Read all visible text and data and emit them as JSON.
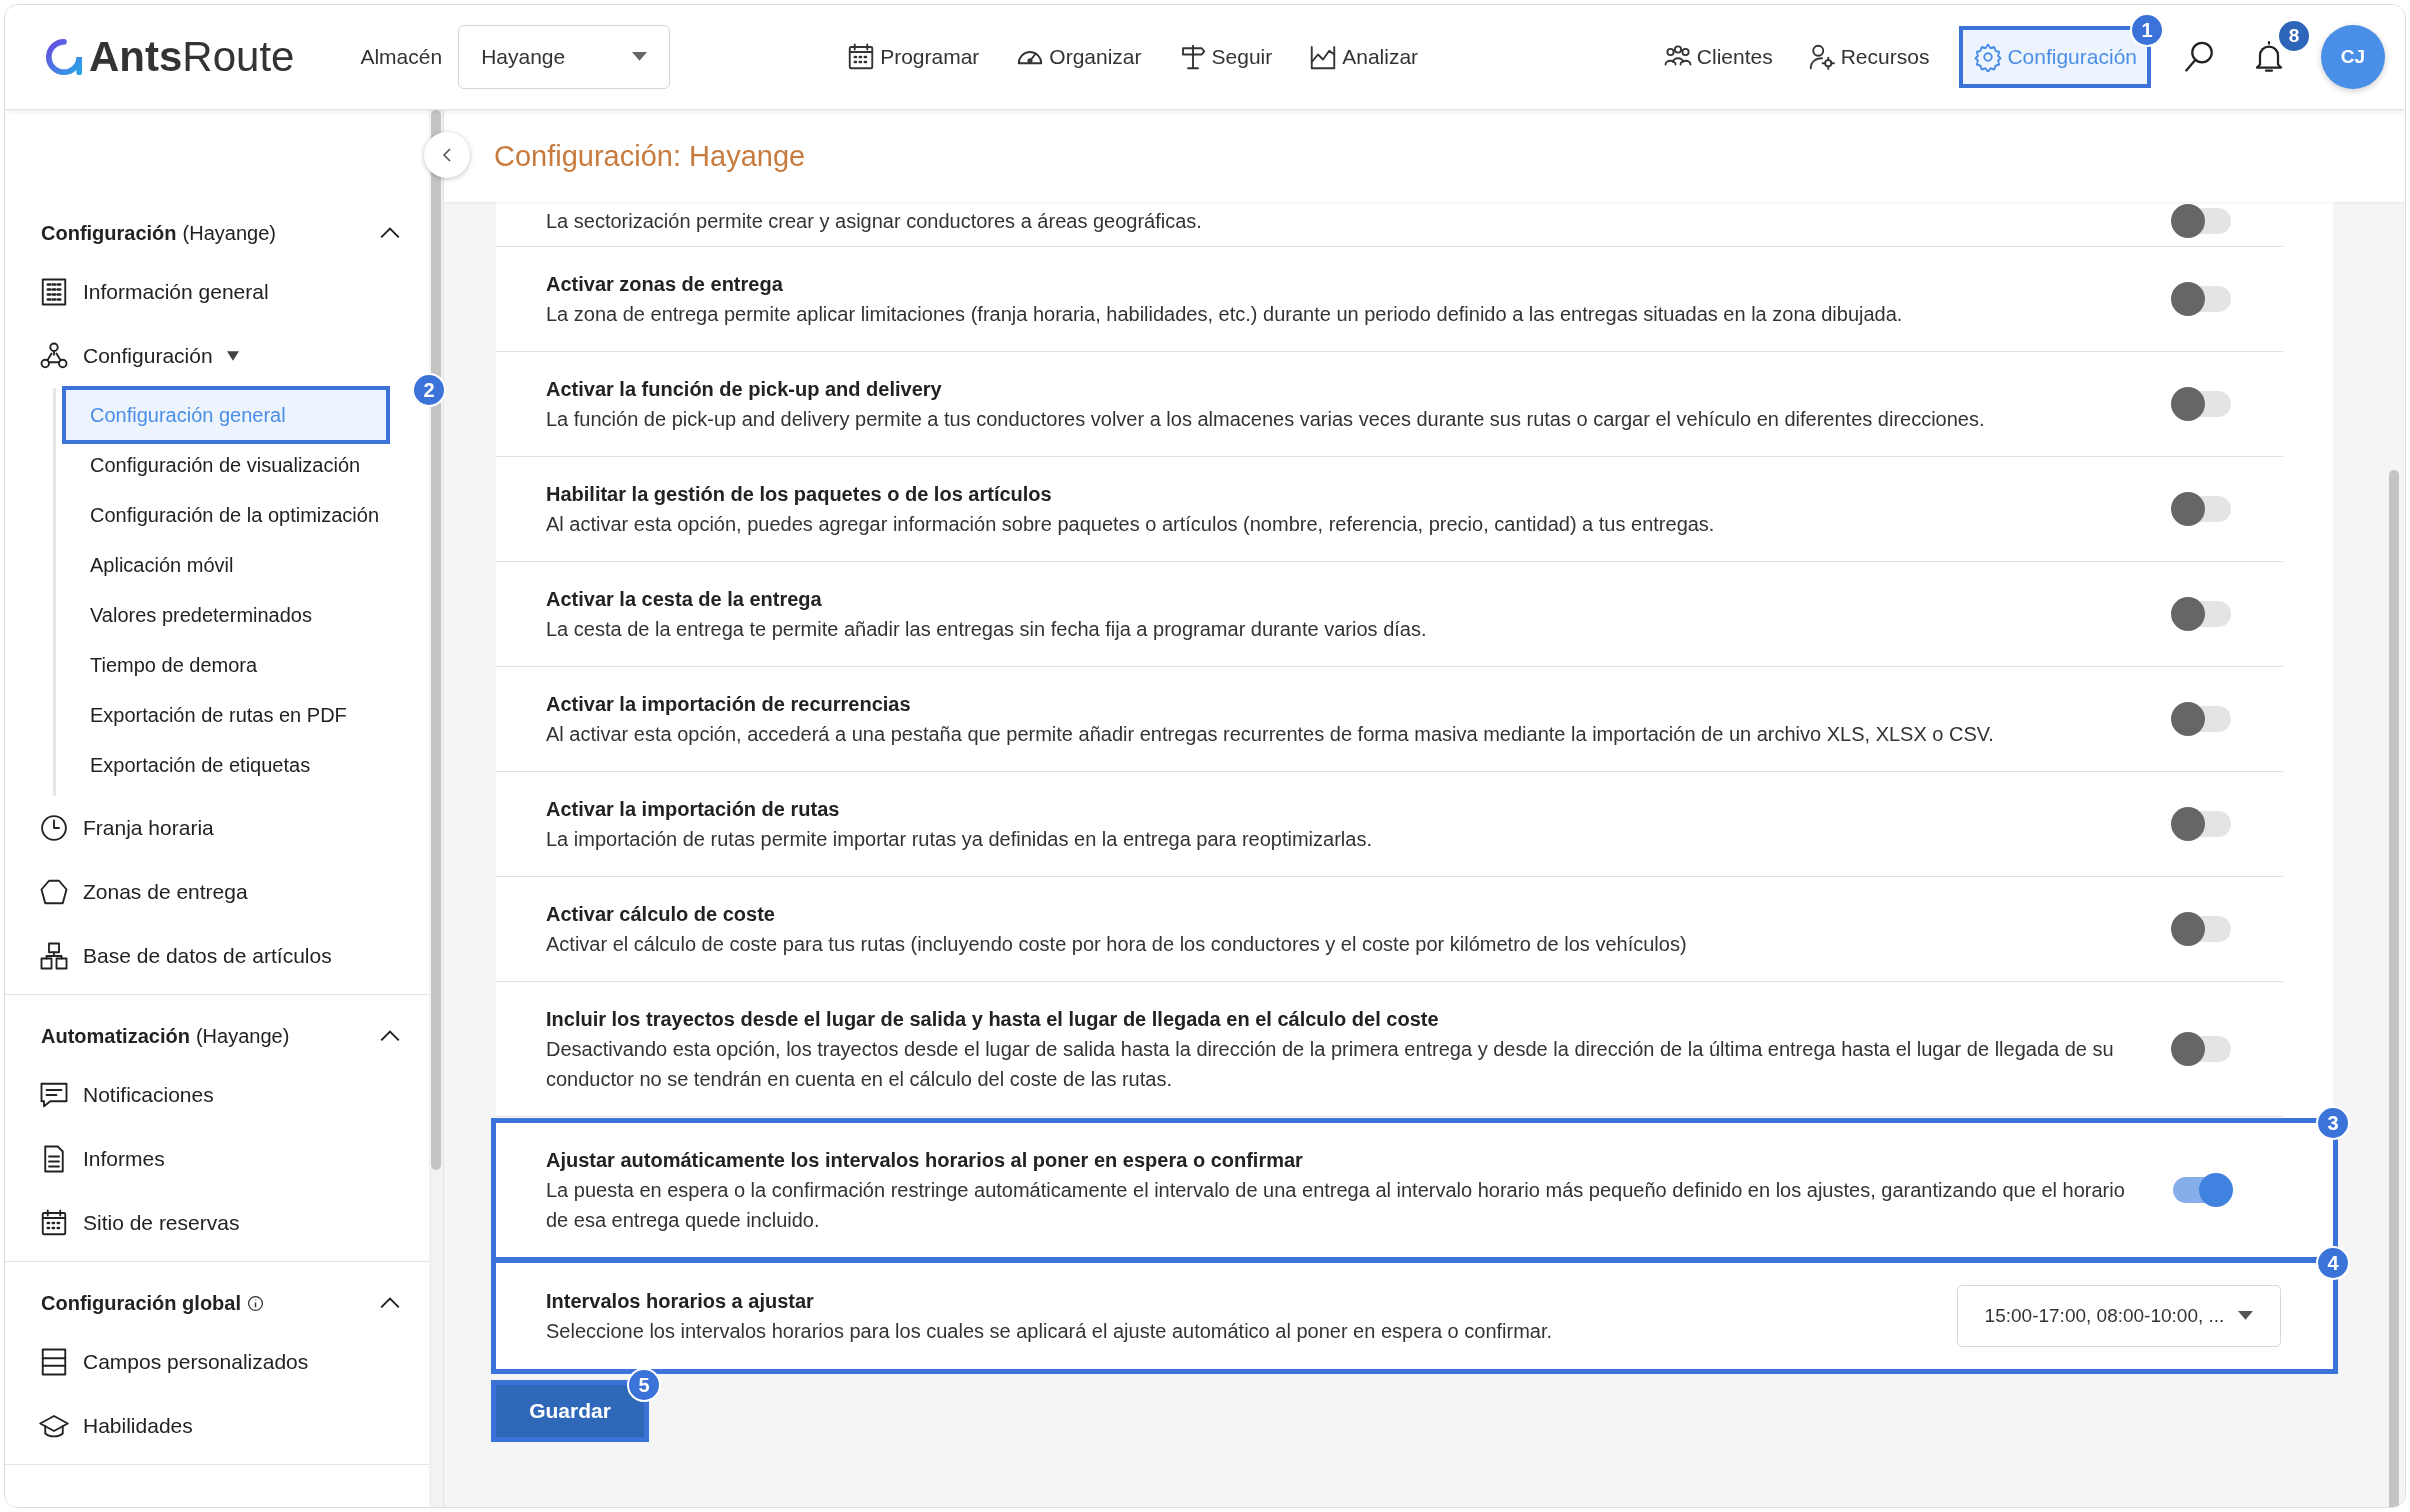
{
  "header": {
    "logo": {
      "bold": "Ants",
      "light": "Route"
    },
    "warehouse_label": "Almacén",
    "warehouse_select": {
      "value": "Hayange"
    },
    "nav": [
      {
        "label": "Programar",
        "selected": false
      },
      {
        "label": "Organizar",
        "selected": false
      },
      {
        "label": "Seguir",
        "selected": false
      },
      {
        "label": "Analizar",
        "selected": false
      }
    ],
    "right_nav": [
      {
        "label": "Clientes",
        "selected": false
      },
      {
        "label": "Recursos",
        "selected": false
      },
      {
        "label": "Configuración",
        "selected": true,
        "marker": "1"
      }
    ],
    "notifications": {
      "count": "8"
    },
    "avatar": "CJ"
  },
  "sidebar": {
    "sections": [
      {
        "title": "Configuración",
        "context": "(Hayange)",
        "expanded": true,
        "items": [
          {
            "label": "Información general",
            "selected": false
          },
          {
            "label": "Configuración",
            "selected": false,
            "expanded": true,
            "children": [
              {
                "label": "Configuración general",
                "selected": true,
                "marker": "2"
              },
              {
                "label": "Configuración de visualización",
                "selected": false
              },
              {
                "label": "Configuración de la optimización",
                "selected": false
              },
              {
                "label": "Aplicación móvil",
                "selected": false
              },
              {
                "label": "Valores predeterminados",
                "selected": false
              },
              {
                "label": "Tiempo de demora",
                "selected": false
              },
              {
                "label": "Exportación de rutas en PDF",
                "selected": false
              },
              {
                "label": "Exportación de etiquetas",
                "selected": false
              }
            ]
          },
          {
            "label": "Franja horaria",
            "selected": false
          },
          {
            "label": "Zonas de entrega",
            "selected": false
          },
          {
            "label": "Base de datos de artículos",
            "selected": false
          }
        ]
      },
      {
        "title": "Automatización",
        "context": "(Hayange)",
        "expanded": true,
        "items": [
          {
            "label": "Notificaciones",
            "selected": false
          },
          {
            "label": "Informes",
            "selected": false
          },
          {
            "label": "Sitio de reservas",
            "selected": false
          }
        ]
      },
      {
        "title": "Configuración global",
        "info": true,
        "expanded": true,
        "items": [
          {
            "label": "Campos personalizados",
            "selected": false
          },
          {
            "label": "Habilidades",
            "selected": false
          }
        ]
      }
    ]
  },
  "main": {
    "title": "Configuración: Hayange",
    "settings": [
      {
        "kind": "toggle",
        "description": "La sectorización permite crear y asignar conductores a áreas geográficas.",
        "on": false
      },
      {
        "kind": "toggle",
        "title": "Activar zonas de entrega",
        "description": "La zona de entrega permite aplicar limitaciones (franja horaria, habilidades, etc.) durante un periodo definido a las entregas situadas en la zona dibujada.",
        "on": false
      },
      {
        "kind": "toggle",
        "title": "Activar la función de pick-up and delivery",
        "description": "La función de pick-up and delivery permite a tus conductores volver a los almacenes varias veces durante sus rutas o cargar el vehículo en diferentes direcciones.",
        "on": false
      },
      {
        "kind": "toggle",
        "title": "Habilitar la gestión de los paquetes o de los artículos",
        "description": "Al activar esta opción, puedes agregar información sobre paquetes o artículos (nombre, referencia, precio, cantidad) a tus entregas.",
        "on": false
      },
      {
        "kind": "toggle",
        "title": "Activar la cesta de la entrega",
        "description": "La cesta de la entrega te permite añadir las entregas sin fecha fija a programar durante varios días.",
        "on": false
      },
      {
        "kind": "toggle",
        "title": "Activar la importación de recurrencias",
        "description": "Al activar esta opción, accederá a una pestaña que permite añadir entregas recurrentes de forma masiva mediante la importación de un archivo XLS, XLSX o CSV.",
        "on": false
      },
      {
        "kind": "toggle",
        "title": "Activar la importación de rutas",
        "description": "La importación de rutas permite importar rutas ya definidas en la entrega para reoptimizarlas.",
        "on": false
      },
      {
        "kind": "toggle",
        "title": "Activar cálculo de coste",
        "description": "Activar el cálculo de coste para tus rutas (incluyendo coste por hora de los conductores y el coste por kilómetro de los vehículos)",
        "on": false
      },
      {
        "kind": "toggle",
        "title": "Incluir los trayectos desde el lugar de salida y hasta el lugar de llegada en el cálculo del coste",
        "description": "Desactivando esta opción, los trayectos desde el lugar de salida hasta la dirección de la primera entrega y desde la dirección de la última entrega hasta el lugar de llegada de su conductor no se tendrán en cuenta en el cálculo del coste de las rutas.",
        "on": false
      },
      {
        "kind": "toggle",
        "title": "Ajustar automáticamente los intervalos horarios al poner en espera o confirmar",
        "description": "La puesta en espera o la confirmación restringe automáticamente el intervalo de una entrega al intervalo horario más pequeño definido en los ajustes, garantizando que el horario de esa entrega quede incluido.",
        "on": true,
        "marker": "3"
      },
      {
        "kind": "select",
        "title": "Intervalos horarios a ajustar",
        "description": "Seleccione los intervalos horarios para los cuales se aplicará el ajuste automático al poner en espera o confirmar.",
        "value": "15:00-17:00, 08:00-10:00, ...",
        "marker": "4"
      }
    ],
    "save_button": {
      "label": "Guardar",
      "marker": "5"
    }
  }
}
